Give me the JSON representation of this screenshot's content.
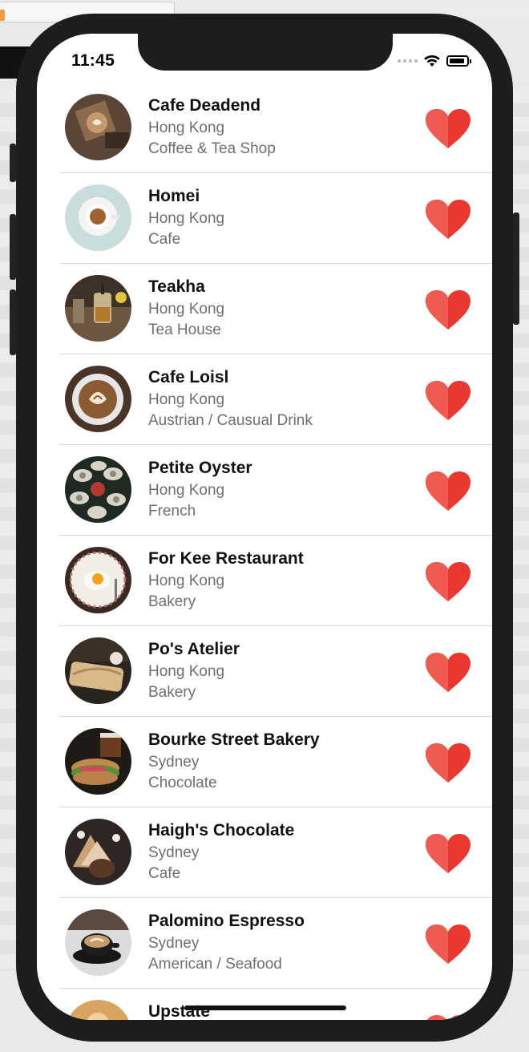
{
  "status_bar": {
    "time": "11:45"
  },
  "colors": {
    "heart": "#e8382f",
    "heart_light": "#ef5a51"
  },
  "restaurants": [
    {
      "name": "Cafe Deadend",
      "location": "Hong Kong",
      "type": "Coffee & Tea Shop",
      "favorite": true
    },
    {
      "name": "Homei",
      "location": "Hong Kong",
      "type": "Cafe",
      "favorite": true
    },
    {
      "name": "Teakha",
      "location": "Hong Kong",
      "type": "Tea House",
      "favorite": true
    },
    {
      "name": "Cafe Loisl",
      "location": "Hong Kong",
      "type": "Austrian / Causual Drink",
      "favorite": true
    },
    {
      "name": "Petite Oyster",
      "location": "Hong Kong",
      "type": "French",
      "favorite": true
    },
    {
      "name": "For Kee Restaurant",
      "location": "Hong Kong",
      "type": "Bakery",
      "favorite": true
    },
    {
      "name": "Po's Atelier",
      "location": "Hong Kong",
      "type": "Bakery",
      "favorite": true
    },
    {
      "name": "Bourke Street Bakery",
      "location": "Sydney",
      "type": "Chocolate",
      "favorite": true
    },
    {
      "name": "Haigh's Chocolate",
      "location": "Sydney",
      "type": "Cafe",
      "favorite": true
    },
    {
      "name": "Palomino Espresso",
      "location": "Sydney",
      "type": "American / Seafood",
      "favorite": true
    },
    {
      "name": "Upstate",
      "location": "",
      "type": "",
      "favorite": true
    }
  ]
}
